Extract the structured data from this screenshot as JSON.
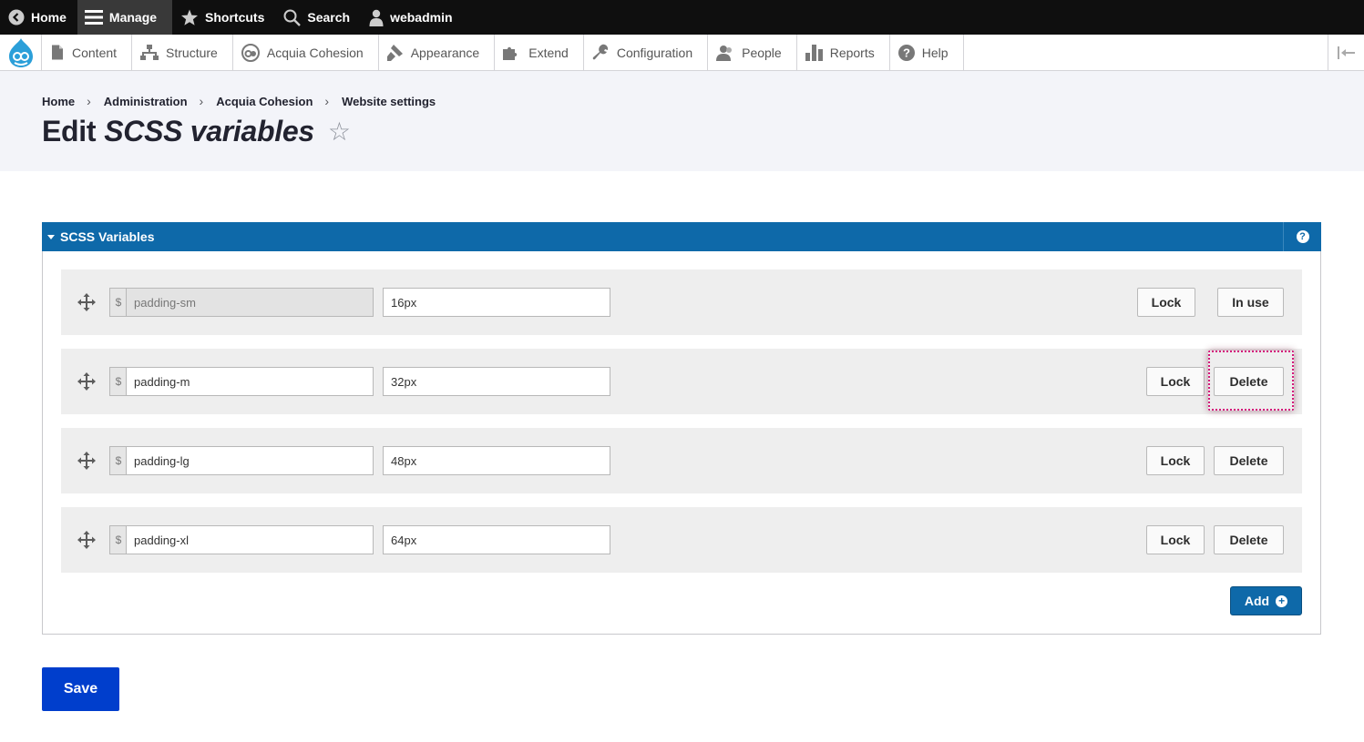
{
  "toolbar": {
    "home": "Home",
    "manage": "Manage",
    "shortcuts": "Shortcuts",
    "search": "Search",
    "user": "webadmin"
  },
  "tray": {
    "items": [
      {
        "label": "Content",
        "icon": "document-icon"
      },
      {
        "label": "Structure",
        "icon": "sitemap-icon"
      },
      {
        "label": "Acquia Cohesion",
        "icon": "cohesion-icon"
      },
      {
        "label": "Appearance",
        "icon": "paintbrush-icon"
      },
      {
        "label": "Extend",
        "icon": "puzzle-icon"
      },
      {
        "label": "Configuration",
        "icon": "wrench-icon"
      },
      {
        "label": "People",
        "icon": "people-icon"
      },
      {
        "label": "Reports",
        "icon": "bar-chart-icon"
      },
      {
        "label": "Help",
        "icon": "help-icon"
      }
    ]
  },
  "breadcrumb": [
    "Home",
    "Administration",
    "Acquia Cohesion",
    "Website settings"
  ],
  "page": {
    "title_prefix": "Edit",
    "title_emphasis": "SCSS variables",
    "star": "☆"
  },
  "panel": {
    "title": "SCSS Variables",
    "help": "?",
    "rows": [
      {
        "prefix": "$",
        "name": "padding-sm",
        "value": "16px",
        "lock": "Lock",
        "action": "In use",
        "name_disabled": true
      },
      {
        "prefix": "$",
        "name": "padding-m",
        "value": "32px",
        "lock": "Lock",
        "action": "Delete",
        "name_disabled": false
      },
      {
        "prefix": "$",
        "name": "padding-lg",
        "value": "48px",
        "lock": "Lock",
        "action": "Delete",
        "name_disabled": false
      },
      {
        "prefix": "$",
        "name": "padding-xl",
        "value": "64px",
        "lock": "Lock",
        "action": "Delete",
        "name_disabled": false
      }
    ],
    "add": "Add"
  },
  "save": "Save",
  "colors": {
    "panel_header": "#0e69a9",
    "save_button": "#003ecc",
    "highlight": "#d4187a"
  }
}
